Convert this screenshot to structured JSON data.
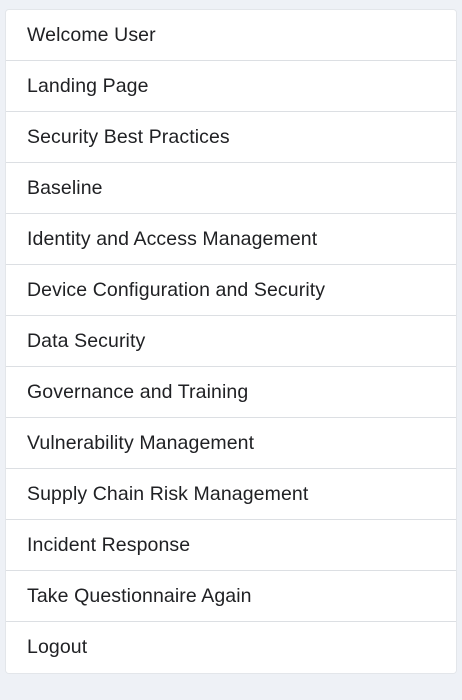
{
  "menu": {
    "items": [
      {
        "label": "Welcome User"
      },
      {
        "label": "Landing Page"
      },
      {
        "label": "Security Best Practices"
      },
      {
        "label": "Baseline"
      },
      {
        "label": "Identity and Access Management"
      },
      {
        "label": "Device Configuration and Security"
      },
      {
        "label": "Data Security"
      },
      {
        "label": "Governance and Training"
      },
      {
        "label": "Vulnerability Management"
      },
      {
        "label": "Supply Chain Risk Management"
      },
      {
        "label": "Incident Response"
      },
      {
        "label": "Take Questionnaire Again"
      },
      {
        "label": "Logout"
      }
    ]
  }
}
